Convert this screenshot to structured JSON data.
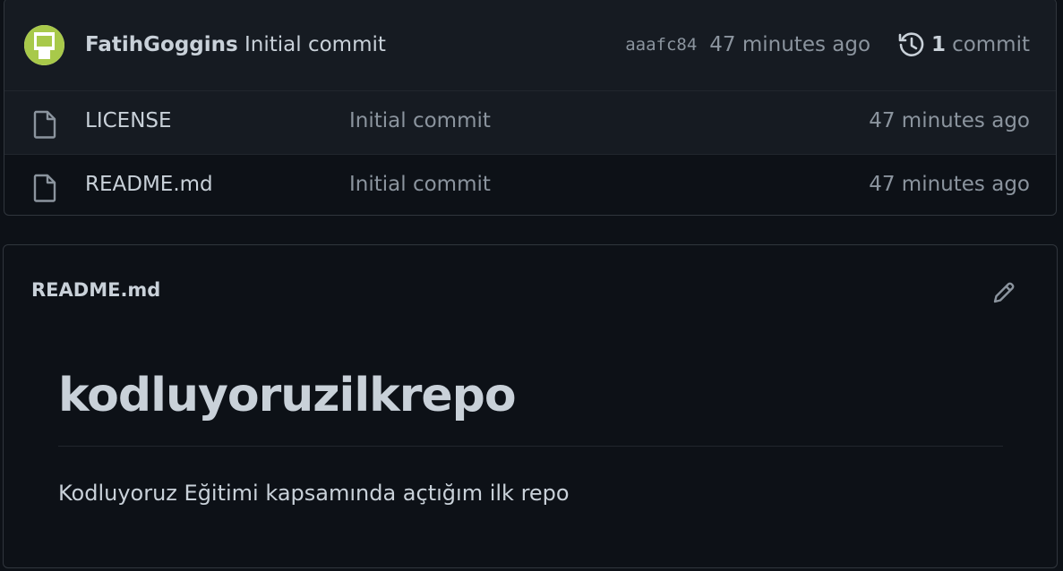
{
  "latest_commit": {
    "author": "FatihGoggins",
    "message": "Initial commit",
    "sha": "aaafc84",
    "time": "47 minutes ago",
    "commit_count": "1",
    "commit_label": "commit"
  },
  "files": [
    {
      "name": "LICENSE",
      "message": "Initial commit",
      "time": "47 minutes ago",
      "icon": "file-icon"
    },
    {
      "name": "README.md",
      "message": "Initial commit",
      "time": "47 minutes ago",
      "icon": "file-icon"
    }
  ],
  "readme": {
    "filename": "README.md",
    "heading": "kodluyoruzilkrepo",
    "paragraph": "Kodluyoruz Eğitimi kapsamında açtığım ilk repo"
  },
  "colors": {
    "background": "#0d1117",
    "header_bg": "#161b22",
    "border": "#30363d",
    "text": "#c9d1d9",
    "muted": "#8b949e",
    "avatar_green": "#a8c94a"
  }
}
